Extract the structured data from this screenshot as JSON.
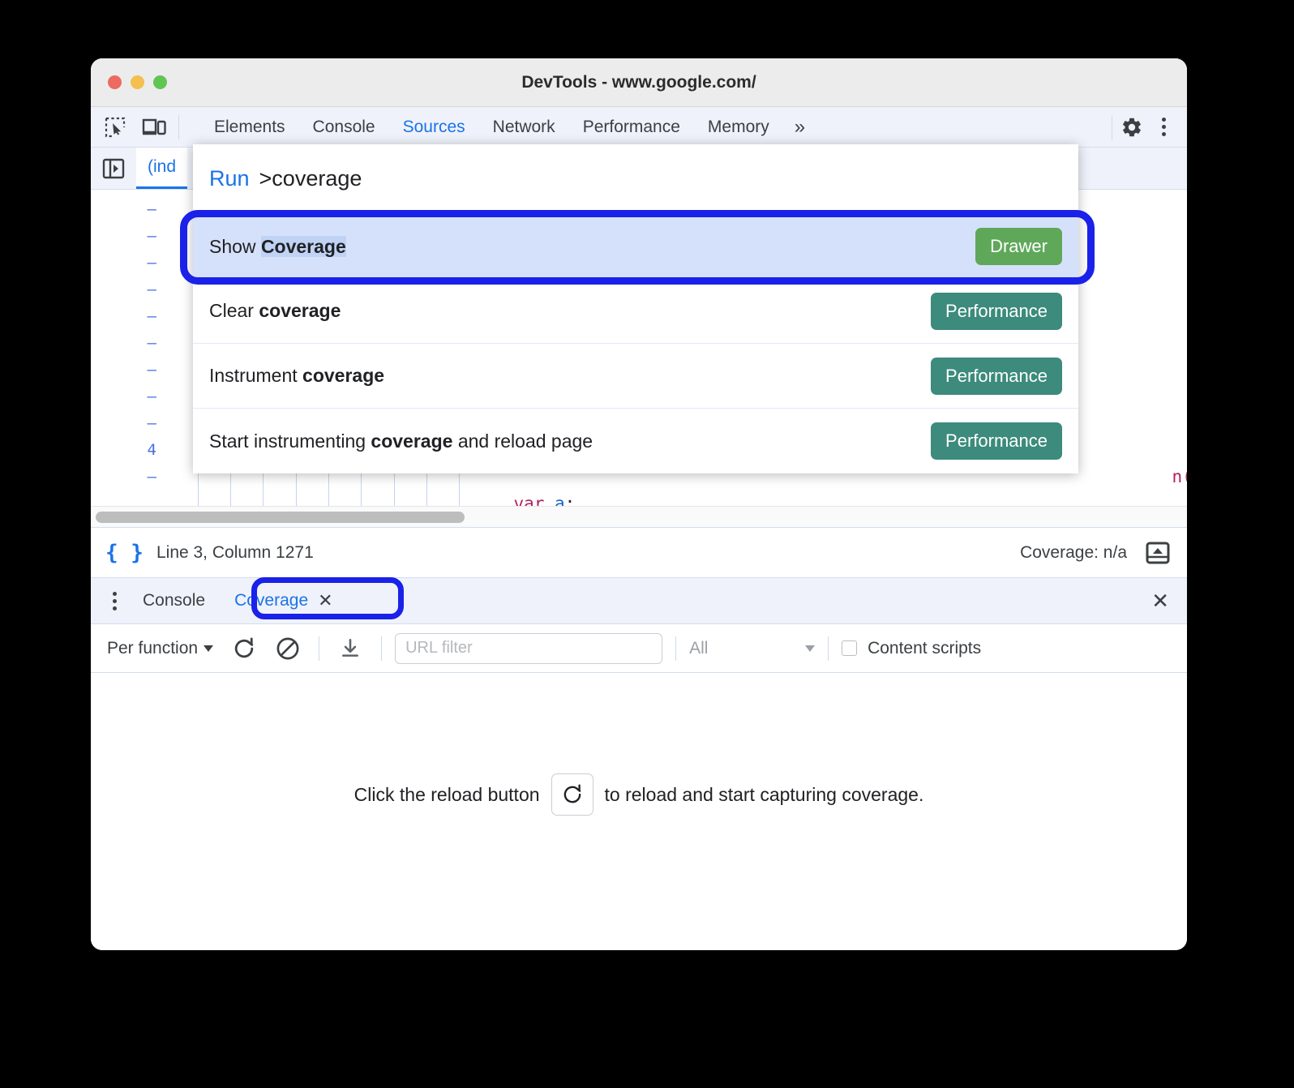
{
  "window": {
    "title": "DevTools - www.google.com/",
    "traffic_lights": [
      "close-red",
      "minimize-yellow",
      "maximize-green"
    ]
  },
  "toolbar": {
    "inspect_icon": "inspect-element-icon",
    "device_icon": "device-toolbar-icon",
    "settings_icon": "gear-icon",
    "more_icon": "kebab-menu-icon",
    "tabs": [
      {
        "label": "Elements",
        "active": false
      },
      {
        "label": "Console",
        "active": false
      },
      {
        "label": "Sources",
        "active": true
      },
      {
        "label": "Network",
        "active": false
      },
      {
        "label": "Performance",
        "active": false
      },
      {
        "label": "Memory",
        "active": false
      }
    ],
    "more_tabs_label": "»"
  },
  "sources": {
    "nav_toggle_icon": "show-navigator-icon",
    "file_tab": "(ind",
    "gutter_lines": [
      "–",
      "–",
      "–",
      "–",
      "–",
      "–",
      "–",
      "–",
      "–",
      "4",
      "–"
    ],
    "code_tail": "n(b) {",
    "code_line": "var a;"
  },
  "palette": {
    "run_label": "Run",
    "query": ">coverage",
    "items": [
      {
        "prefix": "Show ",
        "match": "Coverage",
        "suffix": "",
        "badge": "Drawer",
        "badge_kind": "drawer",
        "selected": true
      },
      {
        "prefix": "Clear ",
        "match": "coverage",
        "suffix": "",
        "badge": "Performance",
        "badge_kind": "perf",
        "selected": false
      },
      {
        "prefix": "Instrument ",
        "match": "coverage",
        "suffix": "",
        "badge": "Performance",
        "badge_kind": "perf",
        "selected": false
      },
      {
        "prefix": "Start instrumenting ",
        "match": "coverage",
        "suffix": " and reload page",
        "badge": "Performance",
        "badge_kind": "perf",
        "selected": false
      }
    ]
  },
  "statusbar": {
    "format_icon": "pretty-print-braces-icon",
    "position": "Line 3, Column 1271",
    "coverage": "Coverage: n/a",
    "drawer_toggle_icon": "show-drawer-icon"
  },
  "drawer": {
    "menu_icon": "kebab-menu-icon",
    "tabs": [
      {
        "label": "Console",
        "active": false,
        "closable": false
      },
      {
        "label": "Coverage",
        "active": true,
        "closable": true,
        "close_glyph": "✕"
      }
    ],
    "close_glyph": "✕"
  },
  "coverage_toolbar": {
    "granularity": "Per function",
    "reload_icon": "reload-icon",
    "clear_icon": "clear-all-icon",
    "export_icon": "download-export-icon",
    "url_filter_placeholder": "URL filter",
    "url_filter_value": "",
    "type_filter": "All",
    "content_scripts_label": "Content scripts",
    "content_scripts_checked": false
  },
  "coverage_empty": {
    "text_before": "Click the reload button",
    "reload_icon": "reload-icon",
    "text_after": "to reload and start capturing coverage."
  },
  "colors": {
    "accent_blue": "#1a73e8",
    "annotation_ring": "#1a21e8",
    "badge_drawer": "#5fa85a",
    "badge_performance": "#3c8b7c",
    "selected_row": "#d5e1fa",
    "toolbar_bg": "#eff2fa"
  }
}
